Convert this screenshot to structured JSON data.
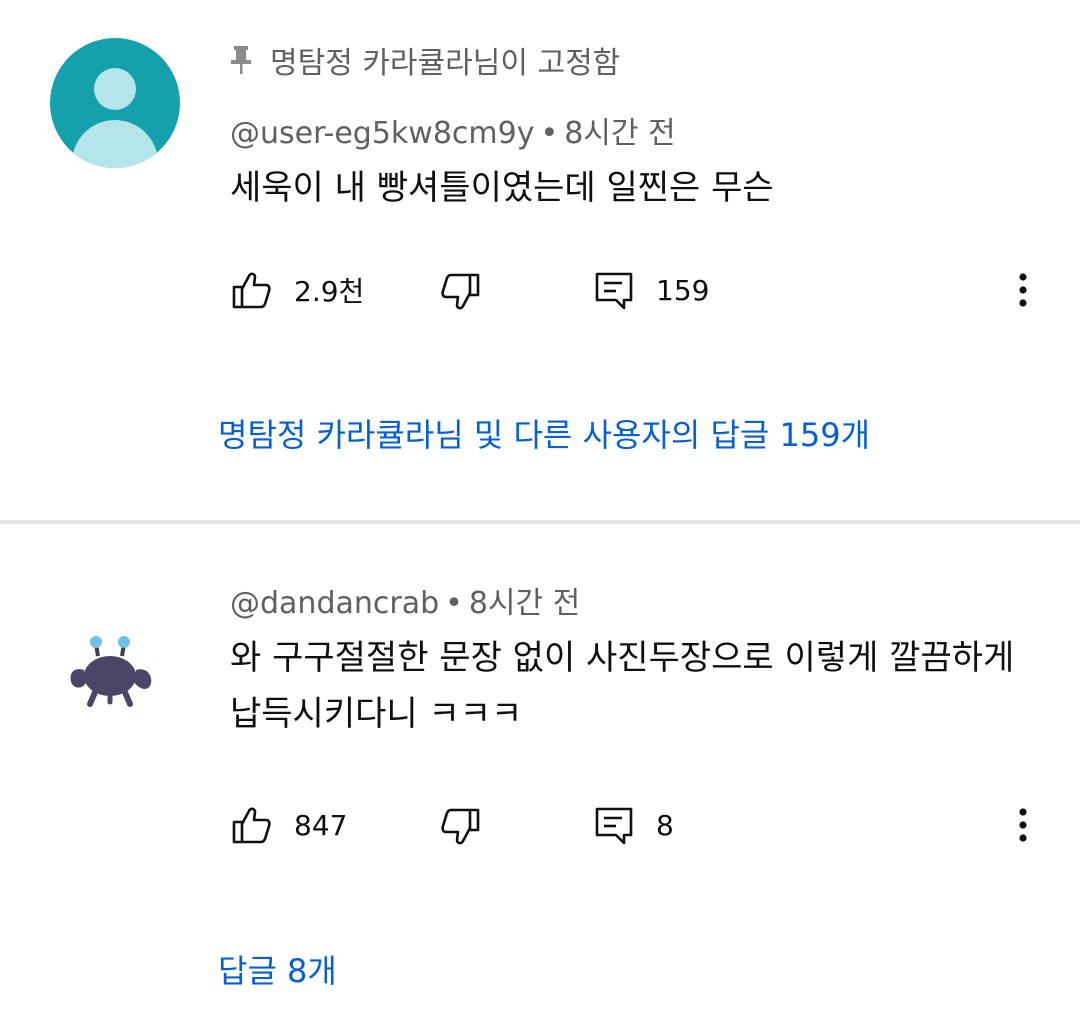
{
  "comments": [
    {
      "pinned_label": "명탐정 카라큘라님이 고정함",
      "author": "@user-eg5kw8cm9y",
      "time": "8시간 전",
      "text": "세욱이 내 빵셔틀이였는데 일찐은 무슨",
      "likes": "2.9천",
      "reply_count": "159",
      "replies_link": "명탐정 카라큘라님 및 다른 사용자의 답글 159개",
      "avatar": "default-user-avatar",
      "avatar_color": "#14a1ab"
    },
    {
      "author": "@dandancrab",
      "time": "8시간 전",
      "text_line1": "와 구구절절한 문장 없이 사진두장으로 이렇게 깔끔하게",
      "text_line2": "납득시키다니 ㅋㅋㅋ",
      "likes": "847",
      "reply_count": "8",
      "replies_link": "답글 8개",
      "avatar": "crab-avatar"
    }
  ],
  "separator_dot": "•",
  "colors": {
    "link": "#065fd4",
    "meta": "#606060",
    "text": "#0f0f0f",
    "divider": "#e5e5e5"
  }
}
